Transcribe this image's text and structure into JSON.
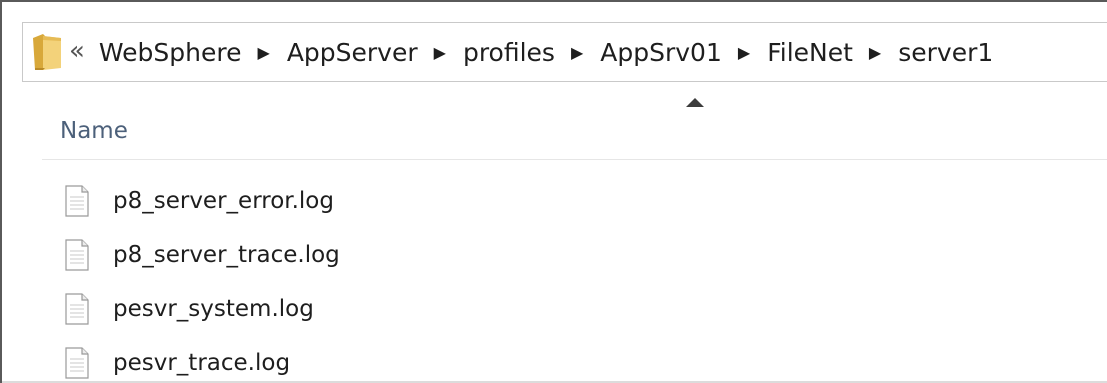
{
  "address_bar": {
    "overflow_chevron": "«",
    "separator": "▶",
    "crumbs": [
      "WebSphere",
      "AppServer",
      "profiles",
      "AppSrv01",
      "FileNet",
      "server1"
    ]
  },
  "column_header": {
    "name_label": "Name",
    "sort_direction": "ascending"
  },
  "files": [
    {
      "name": "p8_server_error.log",
      "icon": "text-file-icon"
    },
    {
      "name": "p8_server_trace.log",
      "icon": "text-file-icon"
    },
    {
      "name": "pesvr_system.log",
      "icon": "text-file-icon"
    },
    {
      "name": "pesvr_trace.log",
      "icon": "text-file-icon"
    }
  ],
  "colors": {
    "folder_yellow": "#e8c25a",
    "header_text": "#4c607a",
    "border": "#5a5a5a"
  }
}
